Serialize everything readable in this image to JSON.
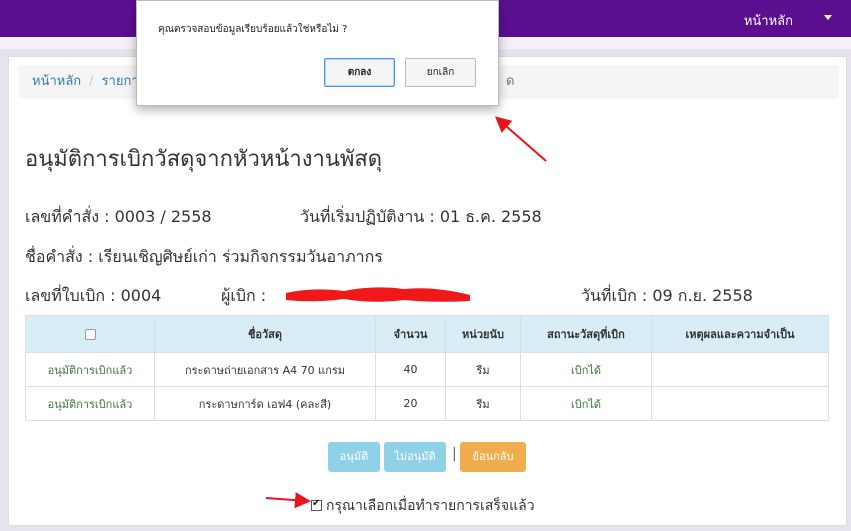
{
  "navbar": {
    "home_label": "หน้าหลัก"
  },
  "breadcrumb": {
    "home": "หน้าหลัก",
    "second": "รายการ",
    "current_fragment": "ด"
  },
  "page": {
    "title": "อนุมัติการเบิกวัสดุจากหัวหน้างานพัสดุ"
  },
  "info": {
    "order_no": "เลขที่คำสั่ง : 0003 / 2558",
    "start_date": "วันที่เริ่มปฏิบัติงาน : 01 ธ.ค. 2558",
    "order_name": "ชื่อคำสั่ง : เรียนเชิญศิษย์เก่า ร่วมกิจกรรมวันอาภากร",
    "slip_no": "เลขที่ใบเบิก : 0004",
    "requester_label": "ผู้เบิก :",
    "request_date": "วันที่เบิก : 09 ก.ย. 2558"
  },
  "table": {
    "headers": [
      "",
      "ชื่อวัสดุ",
      "จำนวน",
      "หน่วยนับ",
      "สถานะวัสดุที่เบิก",
      "เหตุผลและความจำเป็น"
    ],
    "rows": [
      {
        "status": "อนุมัติการเบิกแล้ว",
        "item": "กระดาษถ่ายเอกสาร A4 70 แกรม",
        "qty": "40",
        "unit": "รีม",
        "item_status": "เบิกได้",
        "reason": ""
      },
      {
        "status": "อนุมัติการเบิกแล้ว",
        "item": "กระดาษการ์ด เอฟ4 (คละสี)",
        "qty": "20",
        "unit": "รีม",
        "item_status": "เบิกได้",
        "reason": ""
      }
    ]
  },
  "actions": {
    "approve": "อนุมัติ",
    "reject": "ไม่อนุมัติ",
    "back": "ย้อนกลับ",
    "separator": "|"
  },
  "confirm": {
    "label": "กรุณาเลือกเมื่อทำรายการเสร็จแล้ว",
    "checked": true
  },
  "dialog": {
    "message": "คุณตรวจสอบข้อมูลเรียบร้อยแล้วใช่หรือไม่ ?",
    "ok": "ตกลง",
    "cancel": "ยกเลิก"
  },
  "colors": {
    "navbar": "#5b0f8f",
    "header_row": "#d9edf7",
    "status_green": "#3c763d",
    "back_button": "#f0ad4e",
    "info_button": "#8fd1e8",
    "annotation_red": "#e8141c"
  }
}
